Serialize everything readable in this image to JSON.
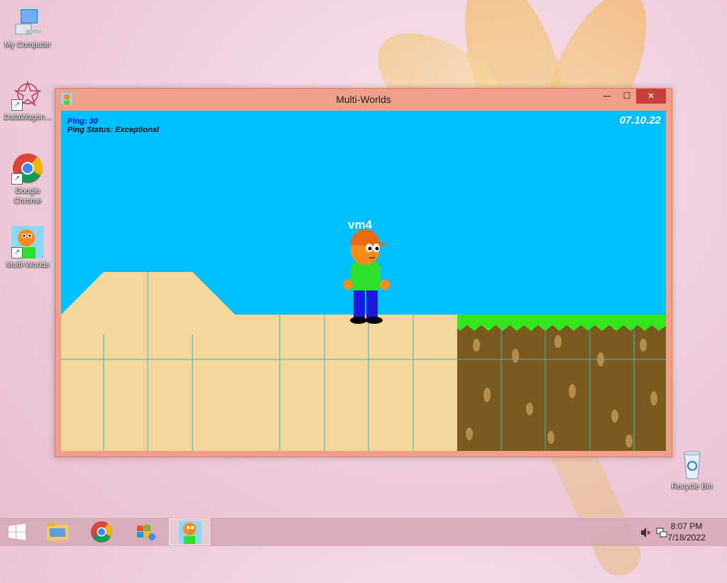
{
  "desktop": {
    "icons": [
      {
        "label": "My Computer"
      },
      {
        "label": "DataWagon..."
      },
      {
        "label": "Google Chrome"
      },
      {
        "label": "Multi-Worlds"
      },
      {
        "label": "Recycle Bin"
      }
    ]
  },
  "window": {
    "title": "Multi-Worlds",
    "controls": {
      "minimize": "—",
      "maximize": "☐",
      "close": "✕"
    }
  },
  "game": {
    "ping": "Ping: 30",
    "ping_status": "Ping Status: Exceptional",
    "date": "07.10.22",
    "player_name": "vm4",
    "colors": {
      "sky": "#00BFFF",
      "sand": "#F5D79B",
      "grass": "#33E61A",
      "dirt": "#7A5A1E"
    }
  },
  "taskbar": {
    "items": [
      {
        "name": "file-explorer"
      },
      {
        "name": "chrome"
      },
      {
        "name": "windows-update"
      },
      {
        "name": "multi-worlds",
        "active": true
      }
    ],
    "clock": {
      "time": "8:07 PM",
      "date": "7/18/2022"
    }
  }
}
